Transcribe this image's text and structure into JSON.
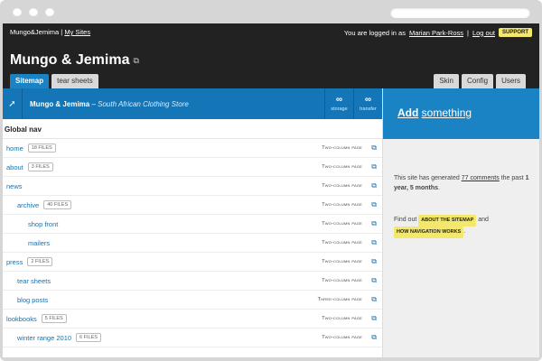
{
  "topbar": {
    "site_name": "Mungo&Jemima",
    "separator": "|",
    "my_sites": "My Sites",
    "logged_in_prefix": "You are logged in as",
    "user_name": "Marian Park-Ross",
    "separator2": "|",
    "logout": "Log out",
    "support": "SUPPORT"
  },
  "site": {
    "title": "Mungo & Jemima"
  },
  "tabs_left": [
    {
      "label": "Sitemap",
      "active": true
    },
    {
      "label": "tear sheets",
      "active": false
    }
  ],
  "tabs_right": [
    {
      "label": "Skin"
    },
    {
      "label": "Config"
    },
    {
      "label": "Users"
    }
  ],
  "sitemap": {
    "site_name": "Mungo & Jemima",
    "dash": " – ",
    "site_desc": "South African Clothing Store",
    "storage_value": "∞",
    "storage_label": "storage",
    "transfer_value": "∞",
    "transfer_label": "transfer",
    "global_nav": "Global nav",
    "rows": [
      {
        "label": "home",
        "files": "18 FILES",
        "template": "Two-column page"
      },
      {
        "label": "about",
        "files": "3 FILES",
        "template": "Two-column page"
      },
      {
        "label": "news",
        "files": "",
        "template": "Two-column page"
      },
      {
        "label": "archive",
        "files": "40 FILES",
        "template": "Two-column page"
      },
      {
        "label": "shop front",
        "files": "",
        "template": "Two-column page"
      },
      {
        "label": "mailers",
        "files": "",
        "template": "Two-column page"
      },
      {
        "label": "press",
        "files": "2 FILES",
        "template": "Two-column page"
      },
      {
        "label": "tear sheets",
        "files": "",
        "template": "Two-column page"
      },
      {
        "label": "blog posts",
        "files": "",
        "template": "Three-column page"
      },
      {
        "label": "lookbooks",
        "files": "5 FILES",
        "template": "Two-column page"
      },
      {
        "label": "winter range 2010",
        "files": "6 FILES",
        "template": "Two-column page"
      }
    ]
  },
  "panel": {
    "add_strong": "Add",
    "add_light": "something",
    "generated_prefix": "This site has generated",
    "comments": "77 comments",
    "generated_mid": "the past",
    "duration": "1 year, 5 months",
    "period": ".",
    "find_out": "Find out",
    "about_sitemap": "ABOUT THE SITEMAP",
    "and": "and",
    "how_nav": "HOW NAVIGATION WORKS",
    "period2": "."
  }
}
